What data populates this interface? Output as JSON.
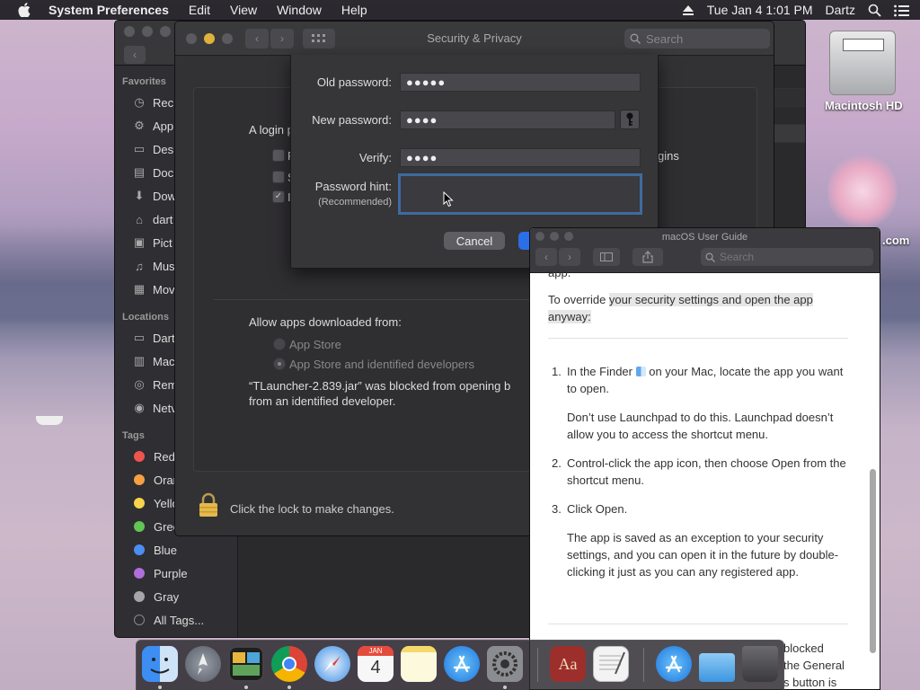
{
  "menubar": {
    "app": "System Preferences",
    "items": [
      "Edit",
      "View",
      "Window",
      "Help"
    ],
    "clock": "Tue Jan 4  1:01 PM",
    "user": "Dartz"
  },
  "desktop": {
    "hd_label": "Macintosh HD",
    "frag_label": ".com"
  },
  "finder": {
    "favorites_head": "Favorites",
    "favorites": [
      {
        "label": "Rec",
        "icon": "clock-icon"
      },
      {
        "label": "App",
        "icon": "apps-icon"
      },
      {
        "label": "Des",
        "icon": "desktop-icon"
      },
      {
        "label": "Doc",
        "icon": "document-icon"
      },
      {
        "label": "Dow",
        "icon": "download-icon"
      },
      {
        "label": "dart",
        "icon": "home-icon"
      },
      {
        "label": "Pict",
        "icon": "camera-icon"
      },
      {
        "label": "Mus",
        "icon": "music-icon"
      },
      {
        "label": "Mov",
        "icon": "film-icon"
      }
    ],
    "locations_head": "Locations",
    "locations": [
      {
        "label": "Dart",
        "icon": "computer-icon"
      },
      {
        "label": "Mac",
        "icon": "drive-icon"
      },
      {
        "label": "Rem",
        "icon": "disc-icon"
      },
      {
        "label": "Netv",
        "icon": "network-icon"
      }
    ],
    "tags_head": "Tags",
    "tags": [
      {
        "label": "Red",
        "color": "#f0544f"
      },
      {
        "label": "Oran",
        "color": "#f5a043"
      },
      {
        "label": "Yello",
        "color": "#f7d44a"
      },
      {
        "label": "Gree",
        "color": "#62c554"
      },
      {
        "label": "Blue",
        "color": "#4b8ef0"
      },
      {
        "label": "Purple",
        "color": "#b06ddb"
      },
      {
        "label": "Gray",
        "color": "#a6a6a8"
      }
    ],
    "all_tags": "All Tags..."
  },
  "security": {
    "title": "Security & Privacy",
    "search_placeholder": "Search",
    "login_frag": "A login p",
    "cb1_frag": "R",
    "cb2_frag": "S",
    "cb3_frag": "I",
    "logins_frag": "gins",
    "allow_label": "Allow apps downloaded from:",
    "radio1": "App Store",
    "radio2": "App Store and identified developers",
    "blocked_line1": "“TLauncher-2.839.jar” was blocked from opening b",
    "blocked_line2": "from an identified developer.",
    "lock_text": "Click the lock to make changes."
  },
  "sheet": {
    "old_label": "Old password:",
    "old_value": "●●●●●",
    "new_label": "New password:",
    "new_value": "●●●●",
    "verify_label": "Verify:",
    "verify_value": "●●●●",
    "hint_label": "Password hint:",
    "hint_sub": "(Recommended)",
    "hint_value": "",
    "cancel": "Cancel",
    "ok": ""
  },
  "guide": {
    "title": "macOS User Guide",
    "search_placeholder": "Search",
    "top_frag": "app.",
    "intro_plain": "To override ",
    "intro_hl": "your security settings and open the app anyway:",
    "steps": [
      {
        "num": "1.",
        "before": "In the Finder",
        "after": " on your Mac, locate the app you want to open."
      },
      {
        "num": "2.",
        "text": "Control-click the app icon, then choose Open from the shortcut menu."
      },
      {
        "num": "3.",
        "text": "Click Open."
      }
    ],
    "note1": "Don’t use Launchpad to do this. Launchpad doesn’t allow you to access the shortcut menu.",
    "note3": "The app is saved as an exception to your security settings, and you can open it in the future by double-clicking it just as you can any registered app.",
    "bottom_frag1": "blocked",
    "bottom_frag2": "the General",
    "bottom_frag3": "s button is"
  },
  "dock": {
    "calendar_month": "JAN",
    "calendar_day": "4",
    "dictionary_glyph": "Aa"
  }
}
